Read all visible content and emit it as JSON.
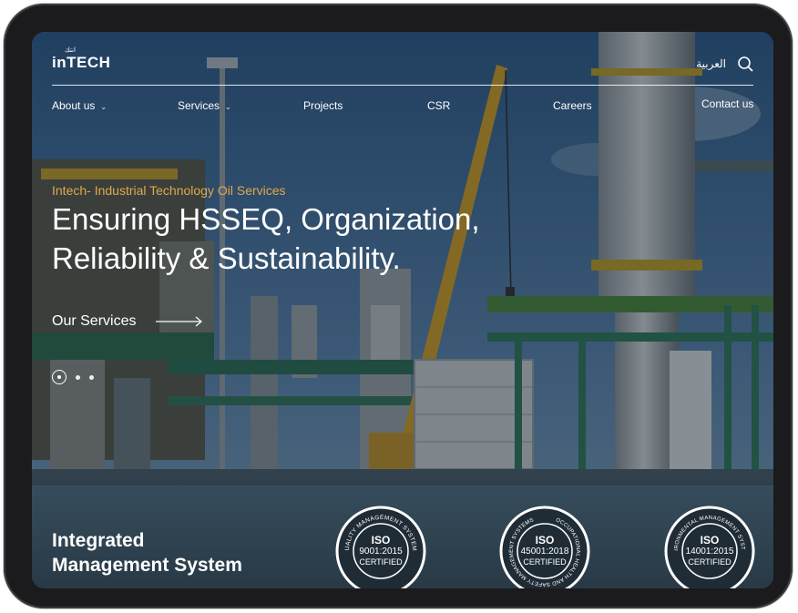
{
  "header": {
    "logo_text": "inTECH",
    "logo_arabic": "انتك",
    "language_link": "العربية"
  },
  "nav": {
    "items": [
      {
        "label": "About us",
        "has_dropdown": true
      },
      {
        "label": "Services",
        "has_dropdown": true
      },
      {
        "label": "Projects",
        "has_dropdown": false
      },
      {
        "label": "CSR",
        "has_dropdown": false
      },
      {
        "label": "Careers",
        "has_dropdown": false
      },
      {
        "label": "Contact us",
        "has_dropdown": false
      }
    ]
  },
  "hero": {
    "eyebrow": "Intech- Industrial Technology Oil Services",
    "headline_line1": "Ensuring HSSEQ, Organization,",
    "headline_line2": "Reliability & Sustainability.",
    "cta_label": "Our Services",
    "slides_total": 3,
    "slide_active": 1
  },
  "ims": {
    "title_line1": "Integrated",
    "title_line2": "Management System"
  },
  "certificates": [
    {
      "arc_text": "QUALITY MANAGEMENT SYSTEMS",
      "standard": "ISO",
      "code": "9001:2015",
      "status": "CERTIFIED"
    },
    {
      "arc_text": "OCCUPATIONAL HEALTH AND SAFETY MANAGEMENT SYSTEMS",
      "standard": "ISO",
      "code": "45001:2018",
      "status": "CERTIFIED"
    },
    {
      "arc_text": "ENVIRONMENTAL MANAGEMENT SYSTEMS",
      "standard": "ISO",
      "code": "14001:2015",
      "status": "CERTIFIED"
    }
  ],
  "colors": {
    "accent": "#e2a84b",
    "sky": "#3f6fa2",
    "crane": "#d9a326",
    "frame": "#1b1b1d"
  }
}
